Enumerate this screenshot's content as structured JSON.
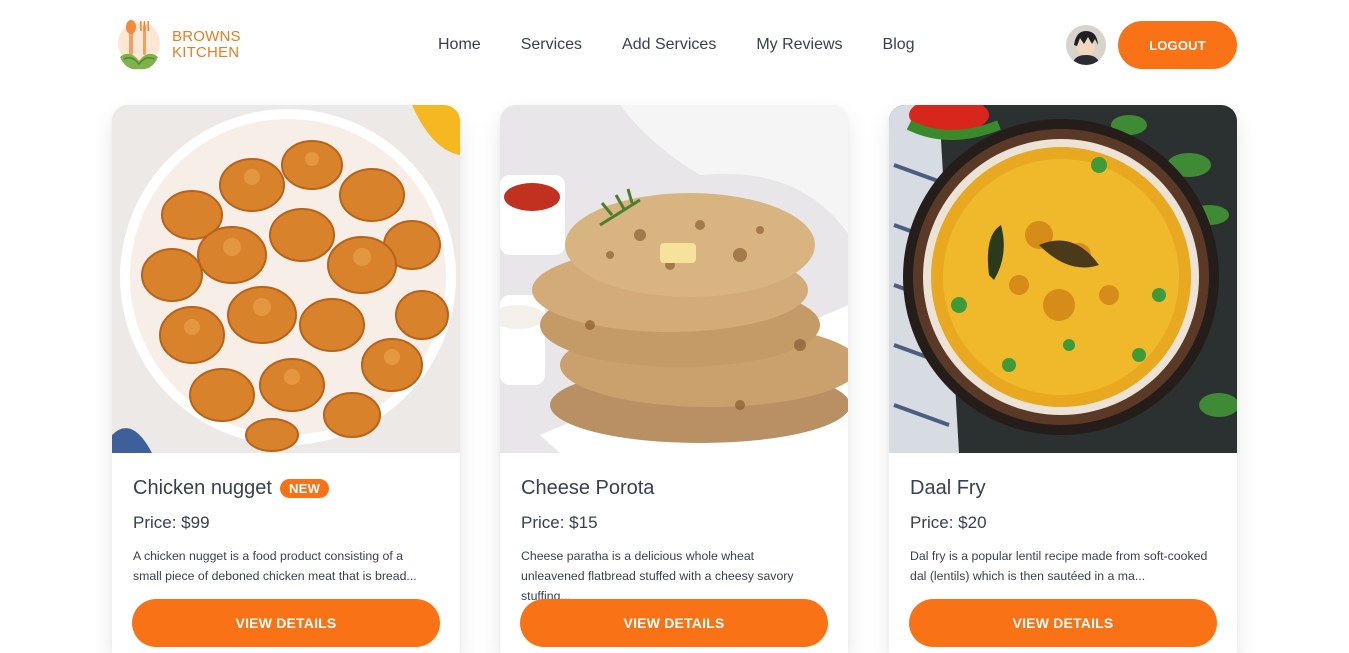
{
  "brand": {
    "line1": "BROWNS",
    "line2": "KITCHEN",
    "logo_icon": "chef-utensils-logo-icon"
  },
  "nav": {
    "items": [
      "Home",
      "Services",
      "Add Services",
      "My Reviews",
      "Blog"
    ]
  },
  "user": {
    "avatar_icon": "user-avatar"
  },
  "logout_label": "LOGOUT",
  "colors": {
    "accent": "#f97316",
    "brand_text": "#f07a1e"
  },
  "cards": [
    {
      "title": "Chicken nugget",
      "badge": "NEW",
      "price": "Price: $99",
      "description": "A chicken nugget is a food product consisting of a small piece of deboned chicken meat that is bread...",
      "button": "VIEW DETAILS",
      "image_icon": "chicken-nuggets-image"
    },
    {
      "title": "Cheese Porota",
      "price": "Price: $15",
      "description": "Cheese paratha is a delicious whole wheat unleavened flatbread stuffed with a cheesy savory stuffing...",
      "button": "VIEW DETAILS",
      "image_icon": "paratha-image"
    },
    {
      "title": "Daal Fry",
      "price": "Price: $20",
      "description": "Dal fry is a popular lentil recipe made from soft-cooked dal (lentils) which is then sautéed in a ma...",
      "button": "VIEW DETAILS",
      "image_icon": "daal-fry-image"
    }
  ]
}
